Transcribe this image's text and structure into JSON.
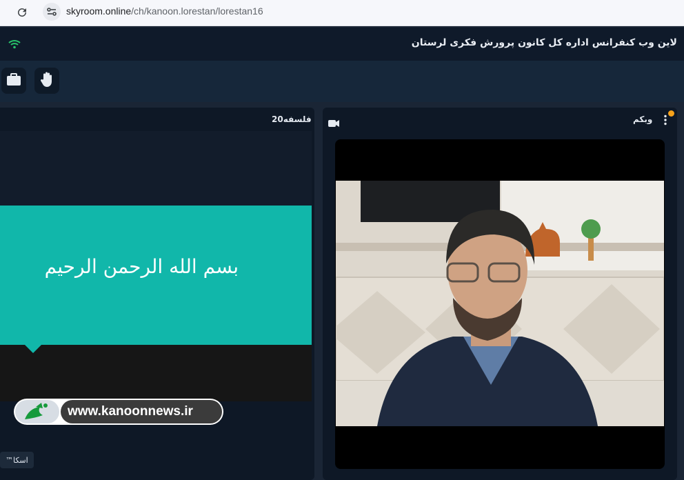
{
  "browser": {
    "url_domain": "skyroom.online",
    "url_path": "/ch/kanoon.lorestan/lorestan16"
  },
  "header": {
    "room_title": "لاین وب کنفرانس اداره کل کانون پرورش فکری لرستان",
    "connection_icon": "wifi-icon"
  },
  "toolbar": {
    "buttons": [
      {
        "name": "briefcase",
        "icon": "briefcase-icon"
      },
      {
        "name": "raise-hand",
        "icon": "hand-icon"
      }
    ]
  },
  "presentation": {
    "title": "فلسفه20",
    "slide_text": "بسم الله الرحمن الرحیم",
    "user_badge": "اسکا™"
  },
  "webcam": {
    "title": "وبکم",
    "icons": [
      "camera-icon",
      "more-vertical-icon"
    ]
  },
  "watermark": {
    "text": "www.kanoonnews.ir"
  },
  "colors": {
    "header_bg": "#0f1a2a",
    "toolbar_bg": "#16273a",
    "slide_teal": "#11b7aa",
    "notify": "#f6a21a"
  }
}
